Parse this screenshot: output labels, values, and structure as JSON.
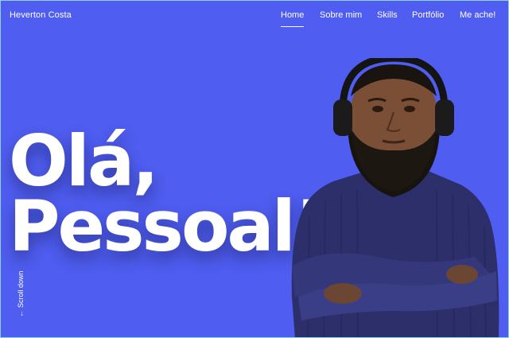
{
  "header": {
    "site_title": "Heverton Costa",
    "nav": [
      {
        "label": "Home",
        "active": true
      },
      {
        "label": "Sobre mim",
        "active": false
      },
      {
        "label": "Skills",
        "active": false
      },
      {
        "label": "Portfólio",
        "active": false
      },
      {
        "label": "Me ache!",
        "active": false
      }
    ]
  },
  "hero": {
    "line1": "Olá,",
    "line2": "Pessoal!",
    "scroll_label": "Scroll down",
    "scroll_arrow": "←"
  },
  "colors": {
    "background": "#4f5df0",
    "text": "#ffffff",
    "frame": "#8fd3e8"
  },
  "icons": {
    "scroll": "arrow-left-icon"
  }
}
